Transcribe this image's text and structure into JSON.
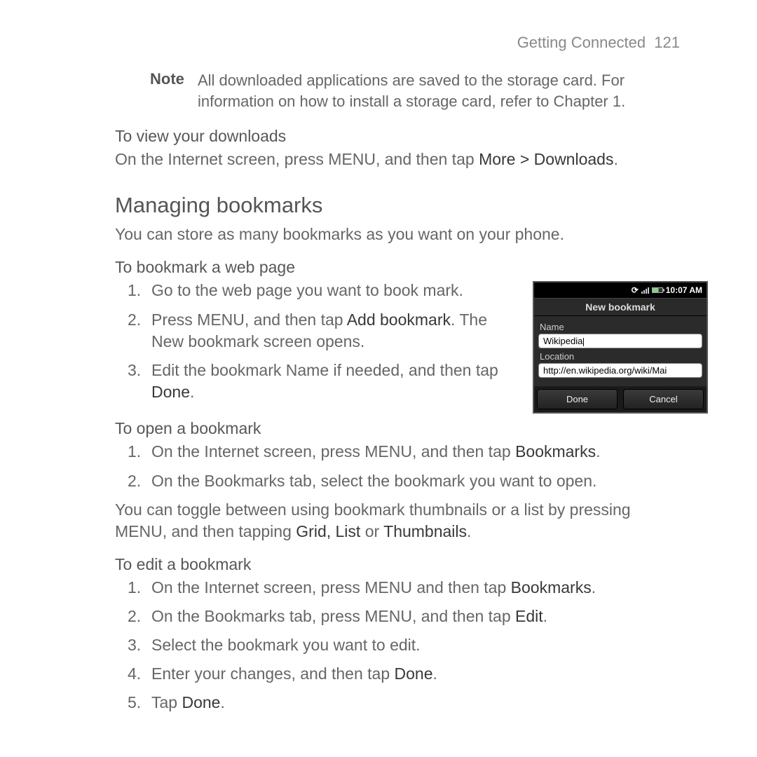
{
  "header": {
    "chapter": "Getting Connected",
    "page": "121"
  },
  "note": {
    "label": "Note",
    "text": "All downloaded applications are saved to the storage card. For information on how to install a storage card, refer to Chapter 1."
  },
  "downloads": {
    "title": "To view your downloads",
    "body_pre": "On the Internet screen, press MENU, and then tap ",
    "body_bold": "More > Downloads",
    "body_post": "."
  },
  "section": {
    "title": "Managing bookmarks",
    "intro": "You can store as many bookmarks as you want on your phone."
  },
  "bookmark_add": {
    "title": "To bookmark a web page",
    "step1": "Go to the web page you want to book mark.",
    "step2_pre": "Press MENU, and then tap ",
    "step2_bold": "Add bookmark",
    "step2_post": ". The New bookmark screen opens.",
    "step3_pre": "Edit the bookmark Name if needed, and then tap ",
    "step3_bold": "Done",
    "step3_post": "."
  },
  "phone": {
    "status_time": "10:07 AM",
    "title": "New bookmark",
    "name_label": "Name",
    "name_value": "Wikipedia",
    "location_label": "Location",
    "location_value": "http://en.wikipedia.org/wiki/Mai",
    "btn_done": "Done",
    "btn_cancel": "Cancel"
  },
  "bookmark_open": {
    "title": "To open a bookmark",
    "step1_pre": "On the Internet screen, press MENU, and then tap ",
    "step1_bold": "Bookmarks",
    "step1_post": ".",
    "step2": "On the Bookmarks tab, select the bookmark you want to open.",
    "toggle_pre": "You can toggle between using bookmark thumbnails or a list by pressing MENU, and then tapping ",
    "toggle_bold1": "Grid, List",
    "toggle_mid": " or ",
    "toggle_bold2": "Thumbnails",
    "toggle_post": "."
  },
  "bookmark_edit": {
    "title": "To edit a bookmark",
    "step1_pre": "On the Internet screen, press MENU and then tap ",
    "step1_bold": "Bookmarks",
    "step1_post": ".",
    "step2_pre": "On the Bookmarks tab, press MENU, and then tap ",
    "step2_bold": "Edit",
    "step2_post": ".",
    "step3": "Select the bookmark you want to edit.",
    "step4_pre": "Enter your changes, and then tap ",
    "step4_bold": "Done",
    "step4_post": ".",
    "step5_pre": "Tap ",
    "step5_bold": "Done",
    "step5_post": "."
  }
}
